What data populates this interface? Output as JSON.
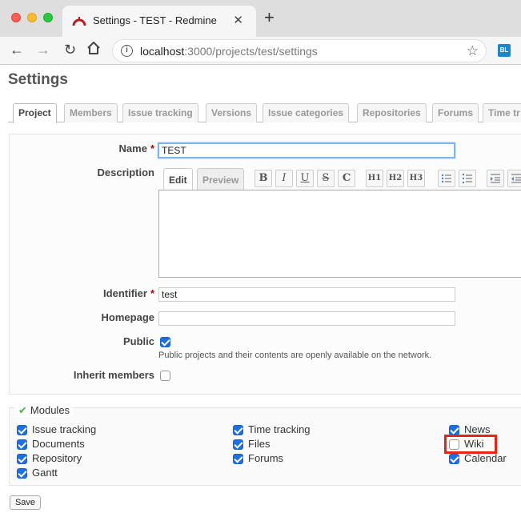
{
  "browser": {
    "tab_title": "Settings - TEST - Redmine",
    "close_glyph": "✕",
    "new_tab_glyph": "+",
    "url_host": "localhost",
    "url_path": ":3000/projects/test/settings",
    "ext_label": "BL"
  },
  "page": {
    "title": "Settings"
  },
  "tabs": [
    "Project",
    "Members",
    "Issue tracking",
    "Versions",
    "Issue categories",
    "Repositories",
    "Forums",
    "Time tr"
  ],
  "form": {
    "name_label": "Name",
    "name_value": "TEST",
    "description_label": "Description",
    "editor_tabs": {
      "edit": "Edit",
      "preview": "Preview"
    },
    "toolbar": {
      "bold": "B",
      "italic": "I",
      "underline": "U",
      "strike": "S",
      "code": "C",
      "h1": "H1",
      "h2": "H2",
      "h3": "H3"
    },
    "identifier_label": "Identifier",
    "identifier_value": "test",
    "homepage_label": "Homepage",
    "homepage_value": "",
    "public_label": "Public",
    "public_checked": true,
    "public_hint": "Public projects and their contents are openly available on the network.",
    "inherit_label": "Inherit members",
    "inherit_checked": false,
    "required_mark": "*"
  },
  "modules": {
    "legend": "Modules",
    "legend_check": "✔",
    "items": [
      {
        "label": "Issue tracking",
        "checked": true
      },
      {
        "label": "Documents",
        "checked": true
      },
      {
        "label": "Repository",
        "checked": true
      },
      {
        "label": "Gantt",
        "checked": true
      },
      {
        "label": "Time tracking",
        "checked": true
      },
      {
        "label": "Files",
        "checked": true
      },
      {
        "label": "Forums",
        "checked": true
      },
      {
        "label": "News",
        "checked": true
      },
      {
        "label": "Wiki",
        "checked": false
      },
      {
        "label": "Calendar",
        "checked": true
      }
    ]
  },
  "actions": {
    "save_label": "Save"
  },
  "colors": {
    "highlight": "#e8231a",
    "checkbox_on": "#1f6fe0"
  }
}
